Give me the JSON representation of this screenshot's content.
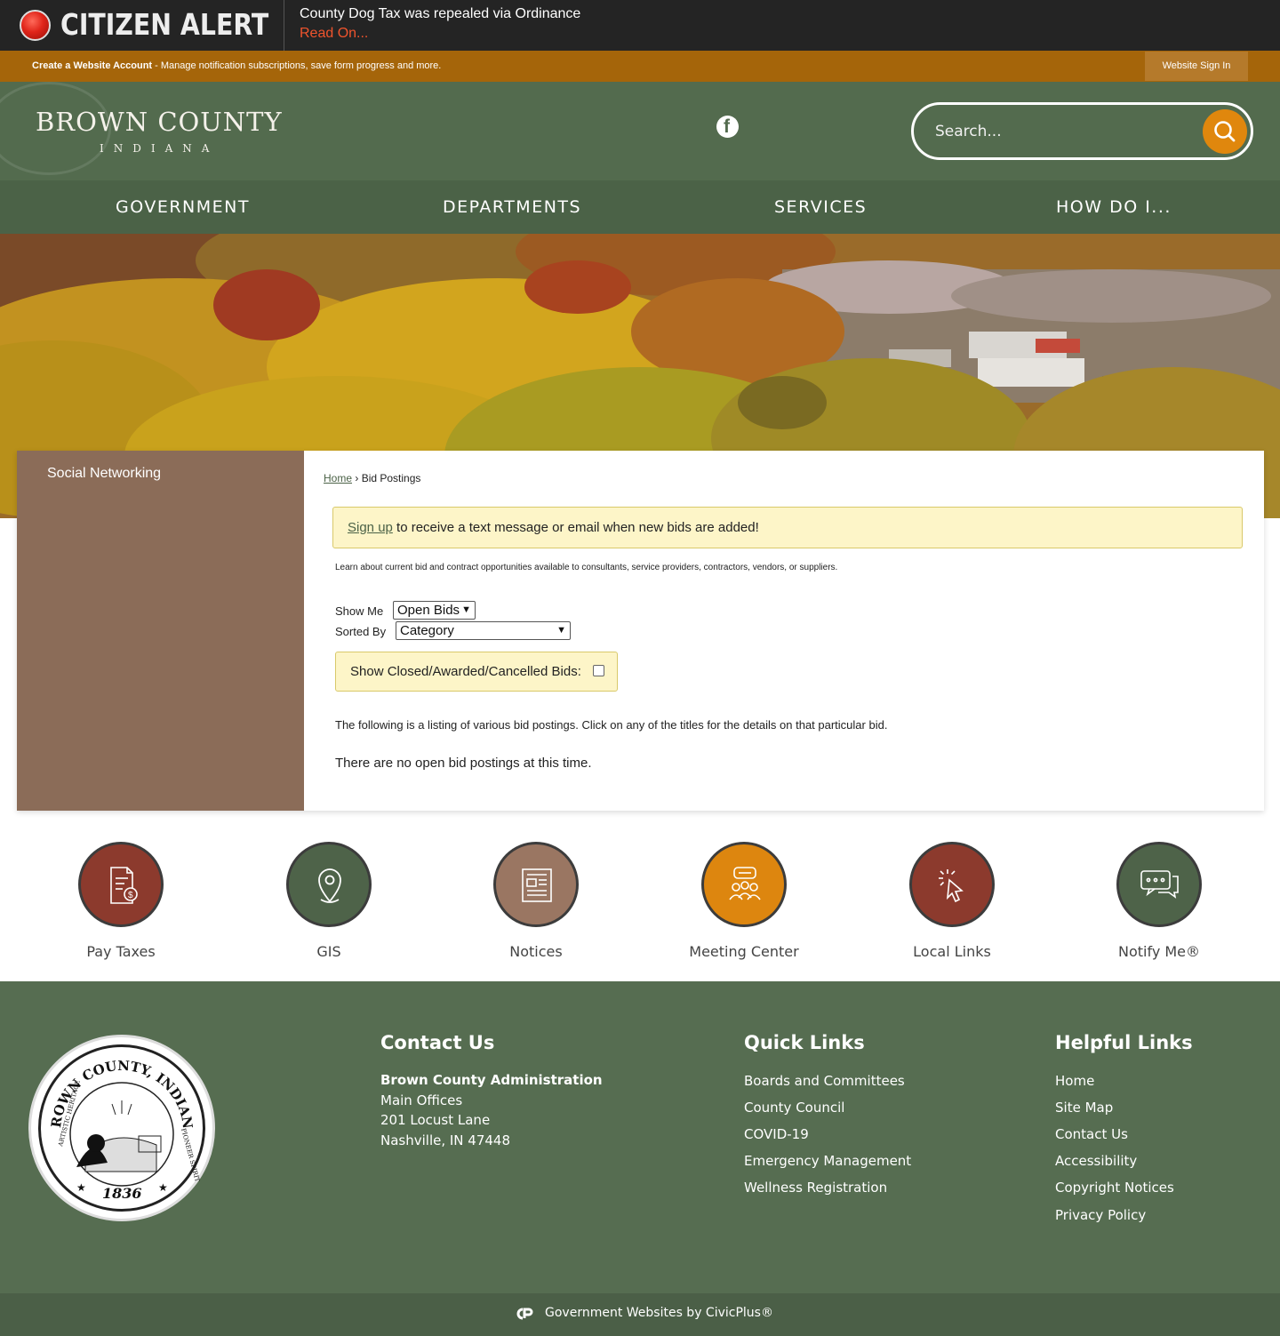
{
  "alert": {
    "title": "CITIZEN ALERT",
    "message": "County Dog Tax was repealed via Ordinance",
    "link": "Read On..."
  },
  "account_bar": {
    "create_label": "Create a Website Account",
    "description": " - Manage notification subscriptions, save form progress and more.",
    "signin_label": "Website Sign In"
  },
  "header": {
    "logo_name": "BROWN COUNTY",
    "logo_sub": "INDIANA",
    "social_icon": "facebook-icon",
    "search_placeholder": "Search..."
  },
  "nav": {
    "items": [
      "GOVERNMENT",
      "DEPARTMENTS",
      "SERVICES",
      "HOW DO I..."
    ]
  },
  "sidebar": {
    "items": [
      "Social Networking"
    ]
  },
  "breadcrumb": {
    "home": "Home",
    "separator": " › ",
    "current": "Bid Postings"
  },
  "notice": {
    "link": "Sign up",
    "text": " to receive a text message or email when new bids are added!"
  },
  "intro": "Learn about current bid and contract opportunities available to consultants, service providers, contractors, vendors, or suppliers.",
  "filters": {
    "show_me_label": "Show Me",
    "show_me_value": "Open Bids",
    "sorted_by_label": "Sorted By",
    "sorted_by_value": "Category",
    "closed_label": "Show Closed/Awarded/Cancelled Bids:",
    "closed_checked": false
  },
  "listing_text": "The following is a listing of various bid postings. Click on any of the titles for the details on that particular bid.",
  "empty_text": "There are no open bid postings at this time.",
  "quick_links": [
    {
      "label": "Pay Taxes",
      "icon": "tax-document-icon",
      "color": "#8c3a2d"
    },
    {
      "label": "GIS",
      "icon": "map-pin-icon",
      "color": "#4e6349"
    },
    {
      "label": "Notices",
      "icon": "newspaper-icon",
      "color": "#9a7662"
    },
    {
      "label": "Meeting Center",
      "icon": "meeting-people-icon",
      "color": "#dd860f"
    },
    {
      "label": "Local Links",
      "icon": "cursor-click-icon",
      "color": "#8c3a2d"
    },
    {
      "label": "Notify Me®",
      "icon": "chat-bubble-icon",
      "color": "#4e6349"
    }
  ],
  "footer": {
    "seal_top": "BROWN COUNTY, INDIANA",
    "seal_left": "ARTISTIC HERITAGE",
    "seal_right": "PIONEER SPIRIT",
    "seal_year": "1836",
    "contact": {
      "heading": "Contact Us",
      "org": "Brown County Administration",
      "line1": "Main Offices",
      "line2": "201 Locust Lane",
      "line3": "Nashville, IN 47448"
    },
    "quick_links": {
      "heading": "Quick Links",
      "items": [
        "Boards and Committees",
        "County Council",
        "COVID-19",
        "Emergency Management",
        "Wellness Registration"
      ]
    },
    "helpful_links": {
      "heading": "Helpful Links",
      "items": [
        "Home",
        "Site Map",
        "Contact Us",
        "Accessibility",
        "Copyright Notices",
        "Privacy Policy"
      ]
    },
    "credit": "Government Websites by CivicPlus®"
  },
  "colors": {
    "alert_bg": "#242424",
    "alert_link": "#f0542d",
    "account_bg": "#a5650a",
    "header_bg": "#536b4e",
    "nav_bg": "#4b6247",
    "sidebar_bg": "#8b6c58",
    "search_button": "#e0870d",
    "notice_bg": "#fdf5c8",
    "footer_bg": "#566d51"
  }
}
